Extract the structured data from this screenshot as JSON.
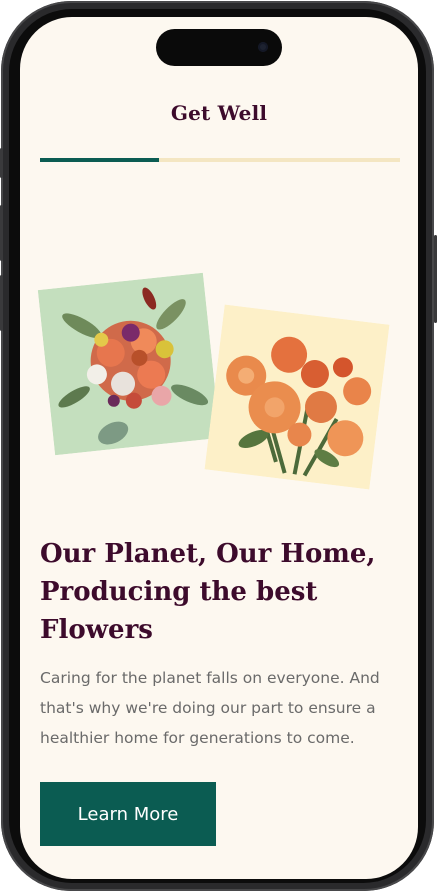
{
  "header": {
    "title": "Get Well"
  },
  "progress": {
    "value": 0.33
  },
  "images": [
    {
      "name": "mixed-bouquet-photo",
      "background": "#c4dfbe"
    },
    {
      "name": "orange-roses-photo",
      "background": "#fdf0c8"
    }
  ],
  "content": {
    "headline": "Our Planet, Our Home, Producing the best Flowers",
    "body": "Caring for the planet falls on everyone. And that's why we're doing our part to ensure a healthier home for generations to come.",
    "cta_label": "Learn More"
  },
  "colors": {
    "background": "#fdf8f0",
    "heading": "#3d0b2c",
    "accent": "#0b5c52",
    "track": "#f4e6c2",
    "body_text": "#6a6a6a"
  }
}
